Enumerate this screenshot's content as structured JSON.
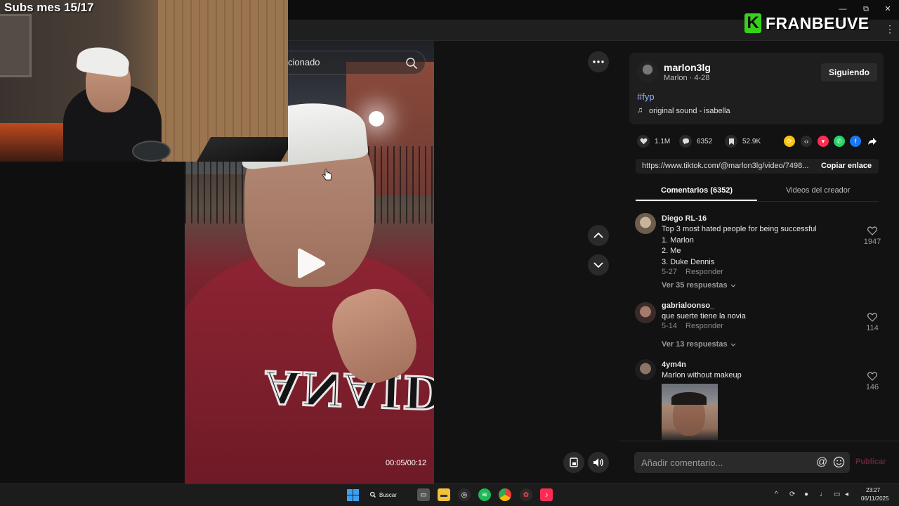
{
  "overlay": {
    "subs_text": "Subs mes 15/17",
    "logo_letter": "K",
    "logo_name": "FRANBEUVE"
  },
  "window_controls": {
    "minimize": "—",
    "restore": "⧉",
    "close": "✕"
  },
  "video": {
    "search_text": "cionado",
    "timecode": "00:05/00:12",
    "progress": 0.46,
    "shirt_text": "ANAIDNI"
  },
  "creator": {
    "username": "marlon3lg",
    "subline": "Marlon · 4-28",
    "follow_label": "Siguiendo",
    "hashtag": "#fyp",
    "sound": "original sound - isabella"
  },
  "stats": {
    "likes": "1.1M",
    "comments": "6352",
    "saves": "52.9K"
  },
  "share_colors": {
    "repost": "#f5c518",
    "embed": "#2a2a2a",
    "send": "#fe2c55",
    "whatsapp": "#25d366",
    "facebook": "#1877f2"
  },
  "link": {
    "url": "https://www.tiktok.com/@marlon3lg/video/7498...",
    "copy_label": "Copiar enlace"
  },
  "tabs": {
    "comments": "Comentarios (6352)",
    "creator_videos": "Videos del creador"
  },
  "comments": [
    {
      "user": "Diego RL-16",
      "lines": [
        "Top 3 most hated people for being successful",
        "1. Marlon",
        "2. Me",
        "3. Duke Dennis"
      ],
      "date": "5-27",
      "reply": "Responder",
      "likes": "1947",
      "more": "Ver 35 respuestas"
    },
    {
      "user": "gabrialoonso_",
      "lines": [
        "que suerte tiene la novia"
      ],
      "date": "5-14",
      "reply": "Responder",
      "likes": "114",
      "more": "Ver 13 respuestas"
    },
    {
      "user": "4ym4n",
      "lines": [
        "Marlon without makeup"
      ],
      "likes": "146"
    }
  ],
  "composer": {
    "placeholder": "Añadir comentario...",
    "mention": "@",
    "publish": "Publicar"
  },
  "taskbar": {
    "search_label": "Buscar",
    "time": "23:27",
    "date": "06/11/2025"
  }
}
